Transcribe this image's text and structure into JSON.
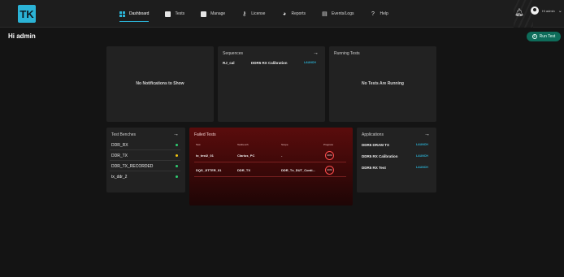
{
  "app": {
    "logo_text": "TK"
  },
  "nav": {
    "items": [
      {
        "label": "Dashboard",
        "icon": "dashboard-grid-icon",
        "active": true
      },
      {
        "label": "Tests",
        "icon": "tests-check-icon",
        "active": false
      },
      {
        "label": "Manage",
        "icon": "manage-icon",
        "active": false
      },
      {
        "label": "License",
        "icon": "license-key-icon",
        "active": false
      },
      {
        "label": "Reports",
        "icon": "reports-icon",
        "active": false
      },
      {
        "label": "Events/Logs",
        "icon": "logs-icon",
        "active": false
      },
      {
        "label": "Help",
        "icon": "help-icon",
        "active": false
      }
    ]
  },
  "user": {
    "label": "Hi admin"
  },
  "page": {
    "greeting": "Hi admin",
    "run_test_label": "Run Test"
  },
  "notifications": {
    "empty_text": "No Notifications to Show"
  },
  "sequences": {
    "title": "Sequences",
    "items": [
      {
        "name": "RJ_cal",
        "description": "DDR5 RX Calibration",
        "action": "LAUNCH"
      }
    ]
  },
  "running_tests": {
    "title": "Running Tests",
    "empty_text": "No Tests Are Running"
  },
  "test_benches": {
    "title": "Test Benches",
    "items": [
      {
        "name": "DDR_RX",
        "status_color": "#2ecc71"
      },
      {
        "name": "DDR_TX",
        "status_color": "#f1c40f"
      },
      {
        "name": "DDR_TX_RECORDED",
        "status_color": "#2ecc71"
      },
      {
        "name": "tx_ddr_2",
        "status_color": "#2ecc71"
      }
    ]
  },
  "failed_tests": {
    "title": "Failed Tests",
    "columns": [
      "Test",
      "Testbench",
      "Scope",
      "Progress"
    ],
    "rows": [
      {
        "test": "tx_test2_01",
        "testbench": "Clarius_PC",
        "scope": "-",
        "progress": "100%"
      },
      {
        "test": "DQS_JITTER_01",
        "testbench": "DDR_TX",
        "scope": "DDR_Tx_DUT_Conti...",
        "progress": "100%"
      }
    ]
  },
  "applications": {
    "title": "Applications",
    "items": [
      {
        "name": "DDR5 DRAM TX",
        "action": "LAUNCH"
      },
      {
        "name": "DDR5 RX Calibration",
        "action": "LAUNCH"
      },
      {
        "name": "DDR5 RX Test",
        "action": "LAUNCH"
      }
    ]
  },
  "colors": {
    "accent": "#2bb3d6",
    "run_button": "#0e6c5a",
    "failed_bg": "#5a0c0c",
    "progress_ring": "#ff4d4d"
  }
}
